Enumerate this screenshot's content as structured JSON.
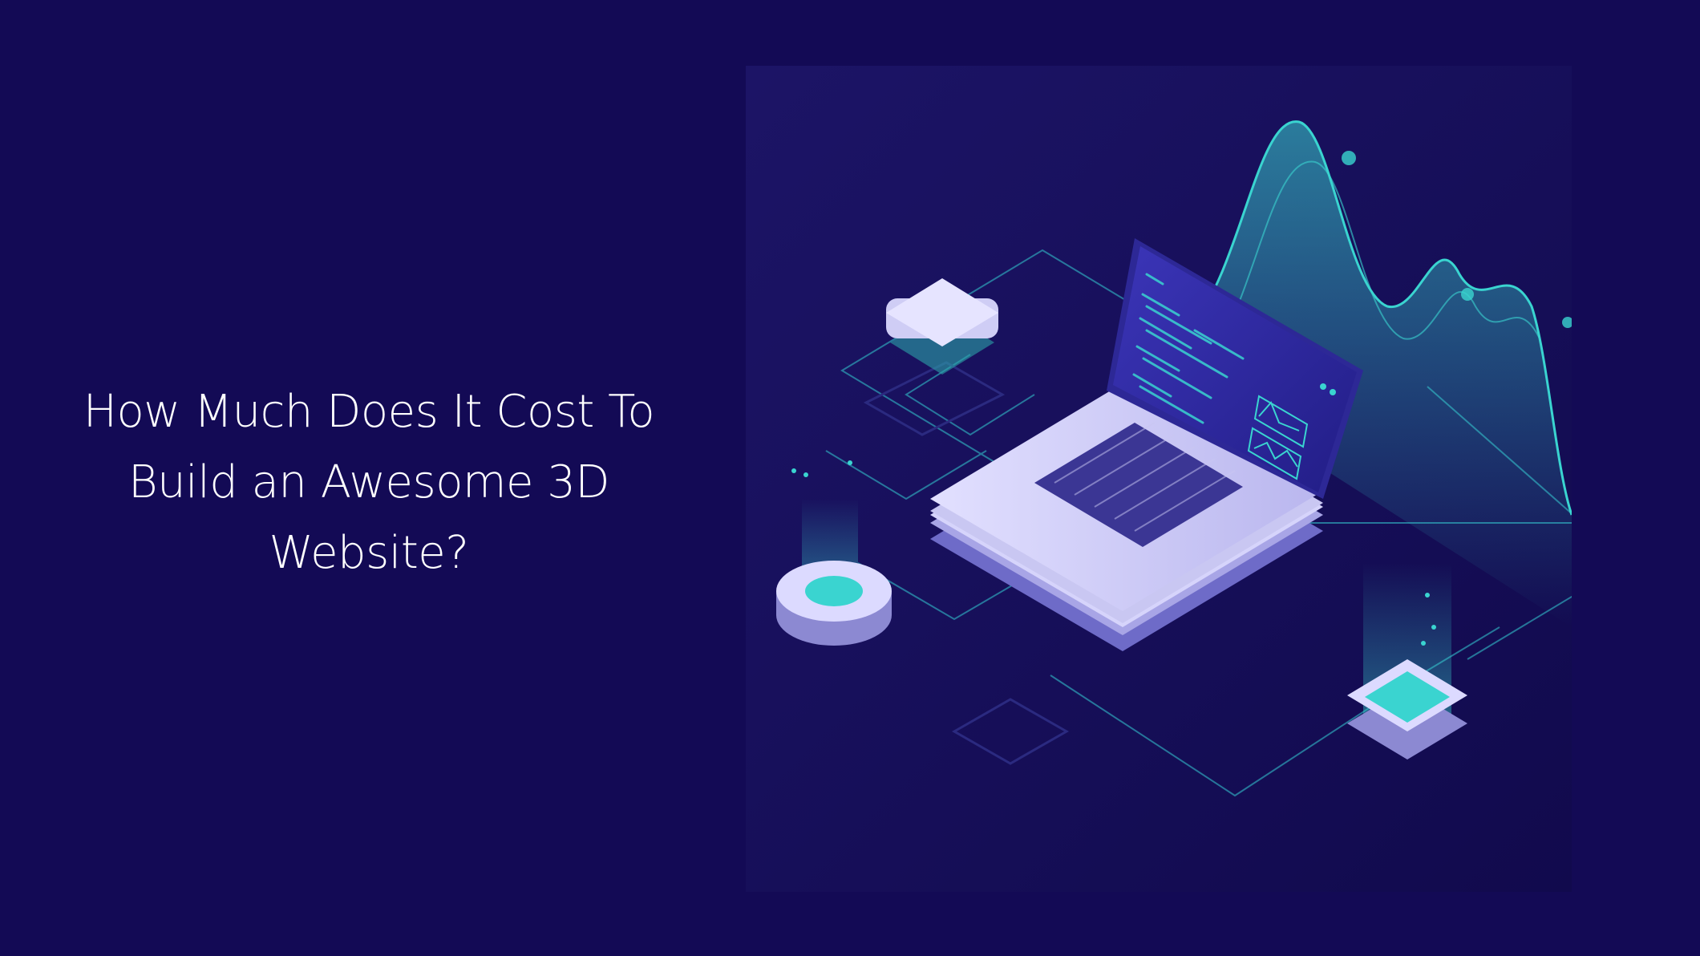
{
  "headline": "How Much Does It Cost To\nBuild an Awesome 3D\nWebsite?",
  "illustration": {
    "icon": "isometric-laptop-code-illustration",
    "colors": {
      "background": "#130a55",
      "panel": "#1a1160",
      "glow": "#3ad4d0",
      "laptop": "#c9c7f2",
      "screen": "#2f2aa3"
    }
  }
}
